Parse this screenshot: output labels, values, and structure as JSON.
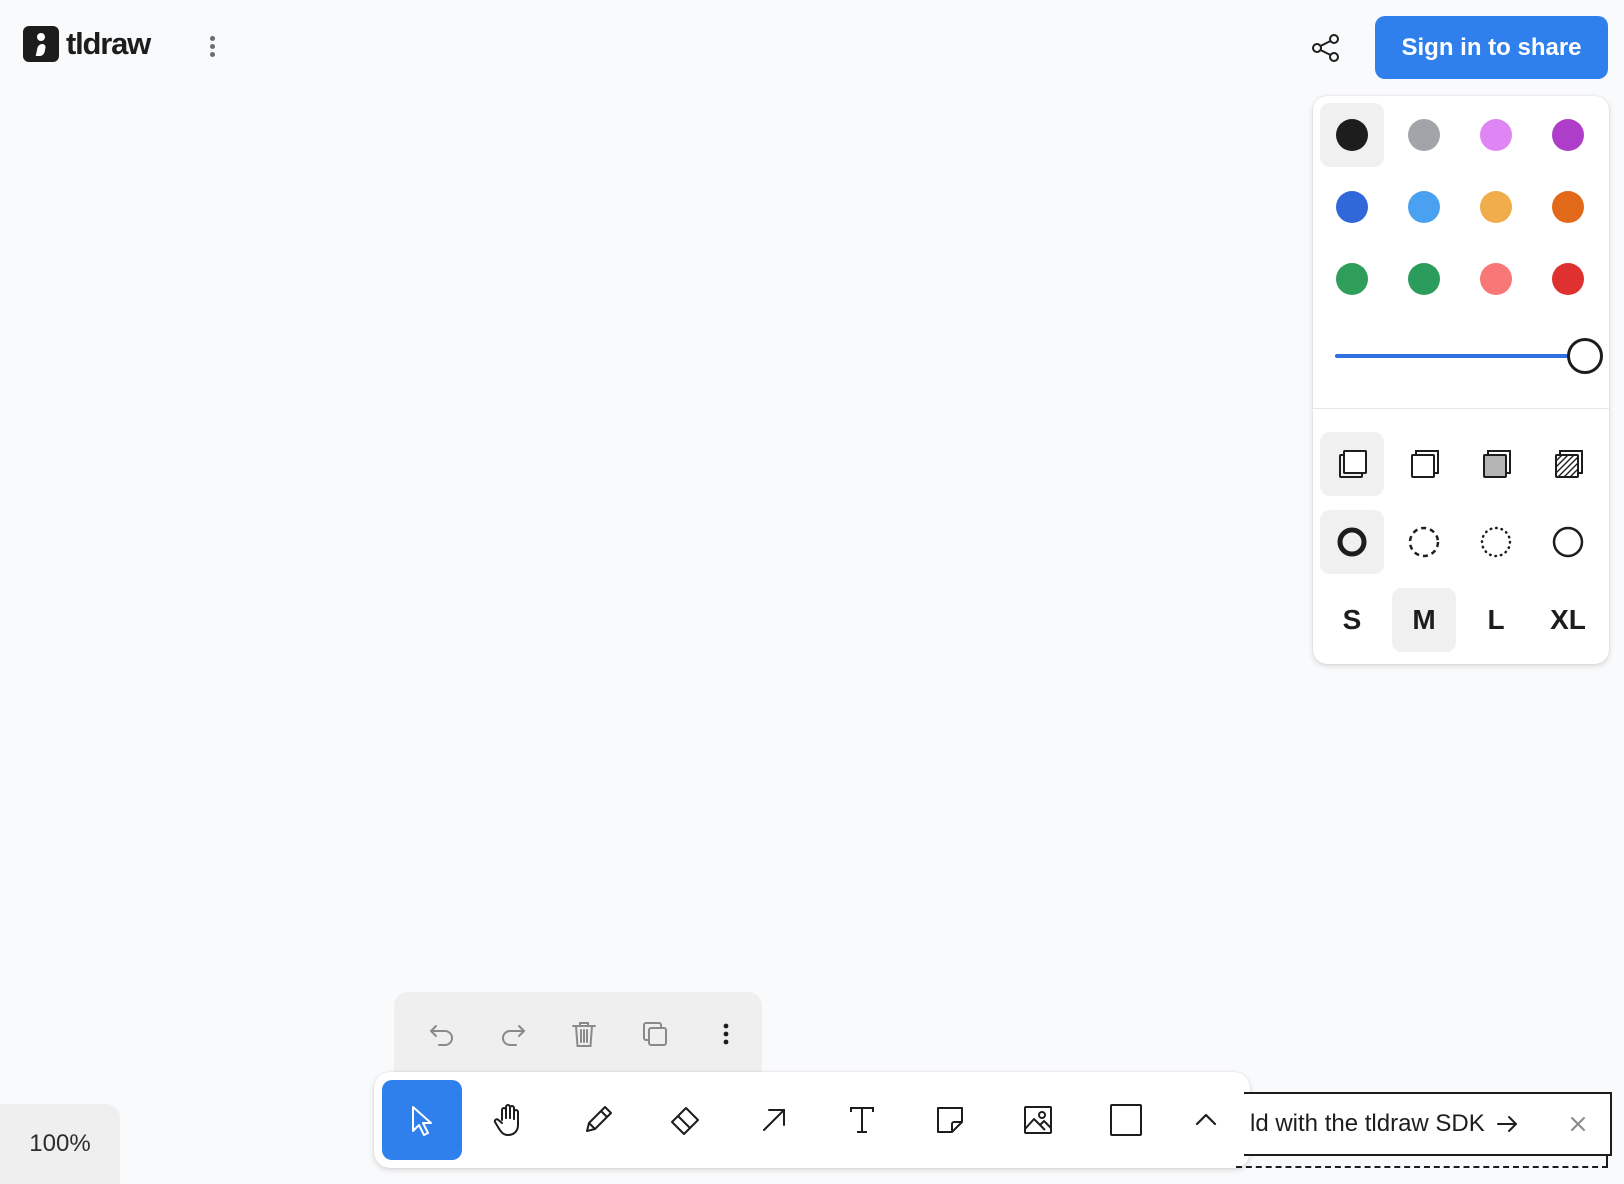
{
  "app": {
    "name": "tldraw"
  },
  "header": {
    "signin_label": "Sign in to share"
  },
  "style_panel": {
    "colors": [
      {
        "name": "black",
        "hex": "#1d1d1d",
        "selected": true
      },
      {
        "name": "grey",
        "hex": "#a1a5aa",
        "selected": false
      },
      {
        "name": "light-violet",
        "hex": "#e085f4",
        "selected": false
      },
      {
        "name": "violet",
        "hex": "#ae3ec9",
        "selected": false
      },
      {
        "name": "blue",
        "hex": "#3068d9",
        "selected": false
      },
      {
        "name": "light-blue",
        "hex": "#4ba1f1",
        "selected": false
      },
      {
        "name": "yellow",
        "hex": "#f1ac4b",
        "selected": false
      },
      {
        "name": "orange",
        "hex": "#e16919",
        "selected": false
      },
      {
        "name": "green",
        "hex": "#2f9e5a",
        "selected": false
      },
      {
        "name": "light-green",
        "hex": "#2b9c5b",
        "selected": false
      },
      {
        "name": "light-red",
        "hex": "#f87777",
        "selected": false
      },
      {
        "name": "red",
        "hex": "#e03131",
        "selected": false
      }
    ],
    "opacity": 1.0,
    "fills": [
      {
        "name": "fill-none-icon",
        "selected": true
      },
      {
        "name": "fill-semi-icon",
        "selected": false
      },
      {
        "name": "fill-solid-icon",
        "selected": false
      },
      {
        "name": "fill-pattern-icon",
        "selected": false
      }
    ],
    "dashes": [
      {
        "name": "dash-draw-icon",
        "selected": true
      },
      {
        "name": "dash-dashed-icon",
        "selected": false
      },
      {
        "name": "dash-dotted-icon",
        "selected": false
      },
      {
        "name": "dash-solid-icon",
        "selected": false
      }
    ],
    "sizes": [
      {
        "label": "S",
        "selected": false
      },
      {
        "label": "M",
        "selected": true
      },
      {
        "label": "L",
        "selected": false
      },
      {
        "label": "XL",
        "selected": false
      }
    ]
  },
  "action_bar": {
    "items": [
      "undo-icon",
      "redo-icon",
      "trash-icon",
      "duplicate-icon",
      "more-vertical-icon"
    ]
  },
  "toolbar": {
    "tools": [
      {
        "name": "select",
        "icon": "cursor-icon",
        "selected": true
      },
      {
        "name": "hand",
        "icon": "hand-icon",
        "selected": false
      },
      {
        "name": "draw",
        "icon": "pencil-icon",
        "selected": false
      },
      {
        "name": "eraser",
        "icon": "eraser-icon",
        "selected": false
      },
      {
        "name": "arrow",
        "icon": "arrow-icon",
        "selected": false
      },
      {
        "name": "text",
        "icon": "text-icon",
        "selected": false
      },
      {
        "name": "note",
        "icon": "note-icon",
        "selected": false
      },
      {
        "name": "image",
        "icon": "image-icon",
        "selected": false
      },
      {
        "name": "rectangle",
        "icon": "rectangle-icon",
        "selected": false
      }
    ]
  },
  "zoom": {
    "label": "100%"
  },
  "sdk_banner": {
    "text": "ld with the tldraw SDK"
  },
  "theme": {
    "accent": "#2f80ed",
    "canvas_bg": "#f9fafb"
  }
}
